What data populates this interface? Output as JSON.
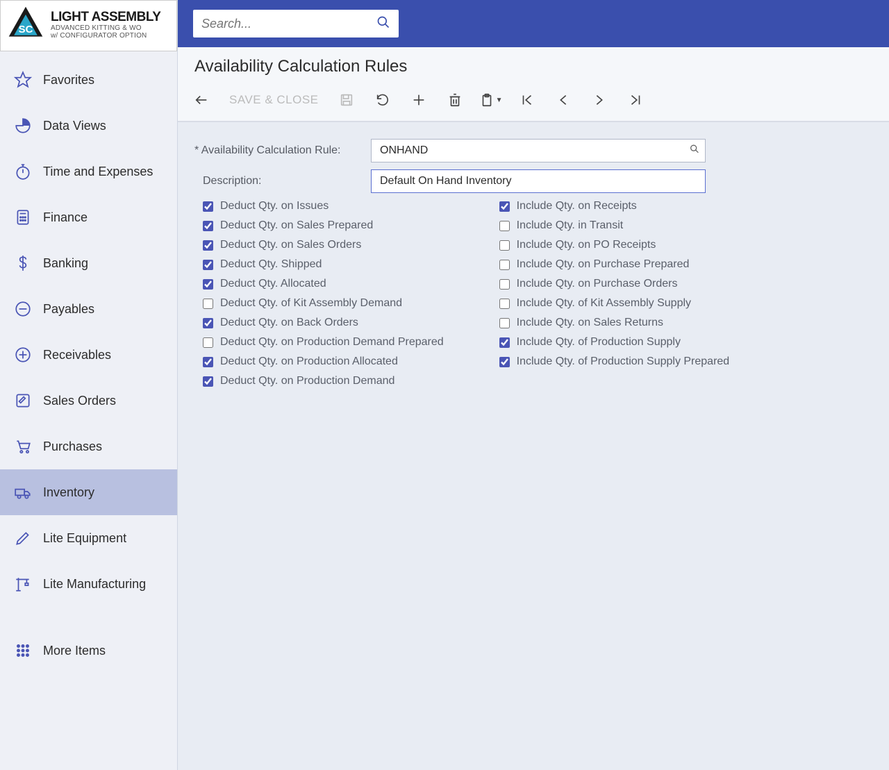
{
  "branding": {
    "title": "LIGHT ASSEMBLY",
    "subtitle1": "ADVANCED KITTING & WO",
    "subtitle2": "w/ CONFIGURATOR OPTION"
  },
  "search": {
    "placeholder": "Search..."
  },
  "nav": {
    "items": [
      {
        "label": "Favorites",
        "icon": "star",
        "active": false
      },
      {
        "label": "Data Views",
        "icon": "pie",
        "active": false
      },
      {
        "label": "Time and Expenses",
        "icon": "stopwatch",
        "active": false
      },
      {
        "label": "Finance",
        "icon": "calculator",
        "active": false
      },
      {
        "label": "Banking",
        "icon": "dollar",
        "active": false
      },
      {
        "label": "Payables",
        "icon": "minus-circle",
        "active": false
      },
      {
        "label": "Receivables",
        "icon": "plus-circle",
        "active": false
      },
      {
        "label": "Sales Orders",
        "icon": "edit-square",
        "active": false
      },
      {
        "label": "Purchases",
        "icon": "cart",
        "active": false
      },
      {
        "label": "Inventory",
        "icon": "truck",
        "active": true
      },
      {
        "label": "Lite Equipment",
        "icon": "pen",
        "active": false
      },
      {
        "label": "Lite Manufacturing",
        "icon": "crane",
        "active": false
      }
    ],
    "more": "More Items"
  },
  "page": {
    "title": "Availability Calculation Rules"
  },
  "toolbar": {
    "save_close": "SAVE & CLOSE"
  },
  "form": {
    "rule_label": "Availability Calculation Rule:",
    "rule_value": "ONHAND",
    "desc_label": "Description:",
    "desc_value": "Default On Hand Inventory",
    "left_checks": [
      {
        "label": "Deduct Qty. on Issues",
        "checked": true
      },
      {
        "label": "Deduct Qty. on Sales Prepared",
        "checked": true
      },
      {
        "label": "Deduct Qty. on Sales Orders",
        "checked": true
      },
      {
        "label": "Deduct Qty. Shipped",
        "checked": true
      },
      {
        "label": "Deduct Qty. Allocated",
        "checked": true
      },
      {
        "label": "Deduct Qty. of Kit Assembly Demand",
        "checked": false
      },
      {
        "label": "Deduct Qty. on Back Orders",
        "checked": true
      },
      {
        "label": "Deduct Qty. on Production Demand Prepared",
        "checked": false
      },
      {
        "label": "Deduct Qty. on Production Allocated",
        "checked": true
      },
      {
        "label": "Deduct Qty. on Production Demand",
        "checked": true
      }
    ],
    "right_checks": [
      {
        "label": "Include Qty. on Receipts",
        "checked": true
      },
      {
        "label": "Include Qty. in Transit",
        "checked": false
      },
      {
        "label": "Include Qty. on PO Receipts",
        "checked": false
      },
      {
        "label": "Include Qty. on Purchase Prepared",
        "checked": false
      },
      {
        "label": "Include Qty. on Purchase Orders",
        "checked": false
      },
      {
        "label": "Include Qty. of Kit Assembly Supply",
        "checked": false
      },
      {
        "label": "Include Qty. on Sales Returns",
        "checked": false
      },
      {
        "label": "Include Qty. of Production Supply",
        "checked": true
      },
      {
        "label": "Include Qty. of Production Supply Prepared",
        "checked": true
      }
    ]
  }
}
